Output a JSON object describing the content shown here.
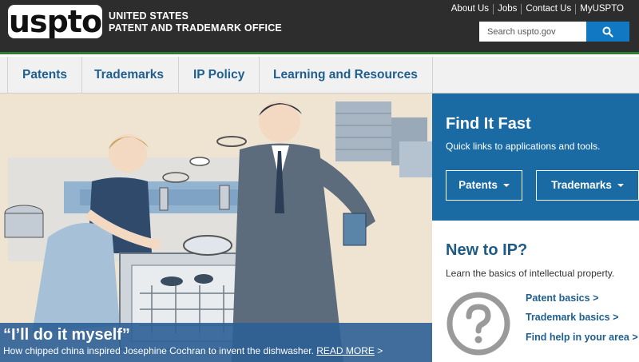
{
  "header": {
    "logo": "uspto",
    "org_line1": "UNITED STATES",
    "org_line2": "PATENT AND TRADEMARK OFFICE",
    "top_links": [
      "About Us",
      "Jobs",
      "Contact Us",
      "MyUSPTO"
    ],
    "search_placeholder": "Search uspto.gov",
    "search_icon": "search-icon"
  },
  "nav": {
    "items": [
      "Patents",
      "Trademarks",
      "IP Policy",
      "Learning and Resources"
    ]
  },
  "hero": {
    "title": "“I’ll do it myself”",
    "subtitle": "How chipped china inspired Josephine Cochran to invent the dishwasher.",
    "read_more": "READ MORE",
    "read_more_arrow": ">"
  },
  "find_fast": {
    "title": "Find It Fast",
    "subtitle": "Quick links to applications and tools.",
    "buttons": [
      "Patents",
      "Trademarks"
    ]
  },
  "new_ip": {
    "title": "New to IP?",
    "subtitle": "Learn the basics of intellectual property.",
    "icon": "question-icon",
    "links": [
      "Patent basics >",
      "Trademark basics >",
      "Find help in your area >"
    ]
  },
  "colors": {
    "header_bg": "#2d2d2d",
    "accent_green": "#2e7d32",
    "search_button": "#1178c3",
    "find_fast_bg": "#1a6ba3",
    "link_blue": "#1f5f8f",
    "caption_bg": "#2c5f96"
  }
}
